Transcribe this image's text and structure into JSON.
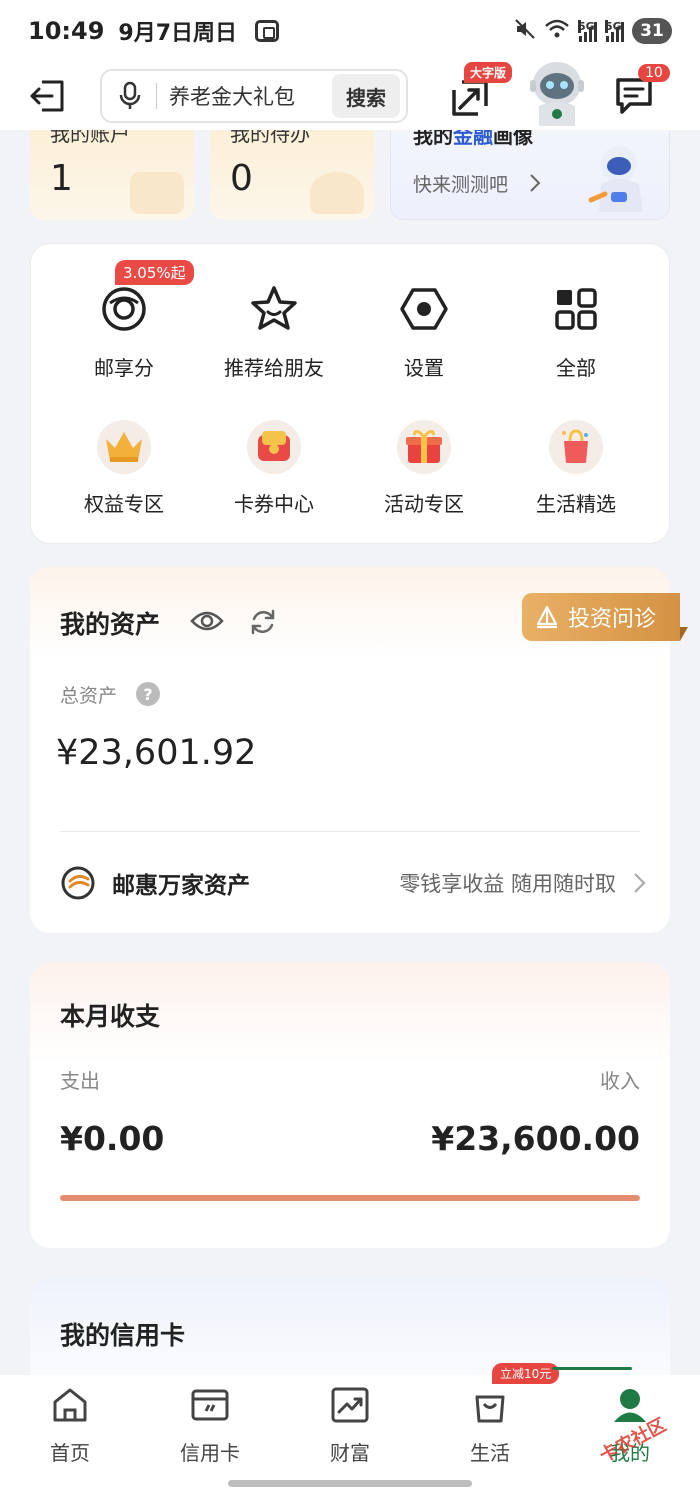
{
  "status_bar": {
    "time": "10:49",
    "date": "9月7日周日",
    "battery": "31",
    "signal_label": "5G",
    "wifi_label": "6"
  },
  "header": {
    "search_text": "养老金大礼包",
    "search_button": "搜索",
    "large_font_badge": "大字版",
    "message_badge": "10"
  },
  "top_cards": {
    "account": {
      "label": "我的账户",
      "value": "1"
    },
    "todo": {
      "label": "我的待办",
      "value": "0"
    },
    "finance": {
      "title_pre": "我的",
      "title_hl": "金融",
      "title_post": "画像",
      "subtitle": "快来测测吧"
    }
  },
  "services": {
    "rate_badge": "3.05%起",
    "items": [
      {
        "label": "邮享分",
        "icon": "points-icon"
      },
      {
        "label": "推荐给朋友",
        "icon": "star-icon"
      },
      {
        "label": "设置",
        "icon": "settings-icon"
      },
      {
        "label": "全部",
        "icon": "grid-icon"
      },
      {
        "label": "权益专区",
        "icon": "crown-icon"
      },
      {
        "label": "卡券中心",
        "icon": "coupon-icon"
      },
      {
        "label": "活动专区",
        "icon": "gift-icon"
      },
      {
        "label": "生活精选",
        "icon": "shopping-bag-icon"
      }
    ]
  },
  "assets": {
    "title": "我的资产",
    "invest_tag": "投资问诊",
    "total_label": "总资产",
    "help": "?",
    "total_value": "¥23,601.92",
    "product_title": "邮惠万家资产",
    "product_desc": "零钱享收益 随用随时取"
  },
  "monthly": {
    "title": "本月收支",
    "expense_label": "支出",
    "income_label": "收入",
    "expense_value": "¥0.00",
    "income_value": "¥23,600.00",
    "income_share": 1.0
  },
  "credit": {
    "title": "我的信用卡"
  },
  "nav": {
    "promo_badge": "立减10元",
    "items": [
      {
        "label": "首页",
        "icon": "home-icon"
      },
      {
        "label": "信用卡",
        "icon": "credit-card-icon"
      },
      {
        "label": "财富",
        "icon": "wealth-chart-icon"
      },
      {
        "label": "生活",
        "icon": "life-bag-icon"
      },
      {
        "label": "我的",
        "icon": "profile-icon"
      }
    ],
    "watermark": "卡农社区"
  },
  "colors": {
    "accent_green": "#1f7a45",
    "badge_red": "#e6463f",
    "invest_gold": "#d49243",
    "income_bar": "#e38d6e"
  }
}
